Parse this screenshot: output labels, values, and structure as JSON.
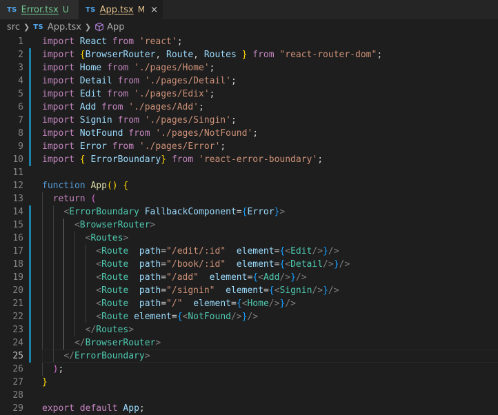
{
  "tabs": [
    {
      "name": "Error.tsx",
      "badge": "TS",
      "status": "U",
      "active": false
    },
    {
      "name": "App.tsx",
      "badge": "TS",
      "status": "M",
      "active": true,
      "close_icon": "×"
    }
  ],
  "breadcrumb": {
    "folder": "src",
    "file_badge": "TS",
    "file": "App.tsx",
    "symbol": "App"
  },
  "editor": {
    "current_line": 25,
    "lines": [
      {
        "n": "1",
        "tokens": [
          [
            "kw",
            "import"
          ],
          [
            "txt",
            " "
          ],
          [
            "var",
            "React"
          ],
          [
            "txt",
            " "
          ],
          [
            "kw",
            "from"
          ],
          [
            "txt",
            " "
          ],
          [
            "str",
            "'react'"
          ],
          [
            "txt",
            ";"
          ]
        ]
      },
      {
        "n": "2",
        "tokens": [
          [
            "kw",
            "import"
          ],
          [
            "txt",
            " "
          ],
          [
            "br1",
            "{"
          ],
          [
            "var",
            "BrowserRouter"
          ],
          [
            "txt",
            ", "
          ],
          [
            "var",
            "Route"
          ],
          [
            "txt",
            ", "
          ],
          [
            "var",
            "Routes"
          ],
          [
            "txt",
            " "
          ],
          [
            "br1",
            "}"
          ],
          [
            "txt",
            " "
          ],
          [
            "kw",
            "from"
          ],
          [
            "txt",
            " "
          ],
          [
            "str",
            "\"react-router-dom\""
          ],
          [
            "txt",
            ";"
          ]
        ]
      },
      {
        "n": "3",
        "tokens": [
          [
            "kw",
            "import"
          ],
          [
            "txt",
            " "
          ],
          [
            "var",
            "Home"
          ],
          [
            "txt",
            " "
          ],
          [
            "kw",
            "from"
          ],
          [
            "txt",
            " "
          ],
          [
            "str",
            "'./pages/Home'"
          ],
          [
            "txt",
            ";"
          ]
        ]
      },
      {
        "n": "4",
        "tokens": [
          [
            "kw",
            "import"
          ],
          [
            "txt",
            " "
          ],
          [
            "var",
            "Detail"
          ],
          [
            "txt",
            " "
          ],
          [
            "kw",
            "from"
          ],
          [
            "txt",
            " "
          ],
          [
            "str",
            "'./pages/Detail'"
          ],
          [
            "txt",
            ";"
          ]
        ]
      },
      {
        "n": "5",
        "tokens": [
          [
            "kw",
            "import"
          ],
          [
            "txt",
            " "
          ],
          [
            "var",
            "Edit"
          ],
          [
            "txt",
            " "
          ],
          [
            "kw",
            "from"
          ],
          [
            "txt",
            " "
          ],
          [
            "str",
            "'./pages/Edix'"
          ],
          [
            "txt",
            ";"
          ]
        ]
      },
      {
        "n": "6",
        "tokens": [
          [
            "kw",
            "import"
          ],
          [
            "txt",
            " "
          ],
          [
            "var",
            "Add"
          ],
          [
            "txt",
            " "
          ],
          [
            "kw",
            "from"
          ],
          [
            "txt",
            " "
          ],
          [
            "str",
            "'./pages/Add'"
          ],
          [
            "txt",
            ";"
          ]
        ]
      },
      {
        "n": "7",
        "tokens": [
          [
            "kw",
            "import"
          ],
          [
            "txt",
            " "
          ],
          [
            "var",
            "Signin"
          ],
          [
            "txt",
            " "
          ],
          [
            "kw",
            "from"
          ],
          [
            "txt",
            " "
          ],
          [
            "str",
            "'./pages/Singin'"
          ],
          [
            "txt",
            ";"
          ]
        ]
      },
      {
        "n": "8",
        "tokens": [
          [
            "kw",
            "import"
          ],
          [
            "txt",
            " "
          ],
          [
            "var",
            "NotFound"
          ],
          [
            "txt",
            " "
          ],
          [
            "kw",
            "from"
          ],
          [
            "txt",
            " "
          ],
          [
            "str",
            "'./pages/NotFound'"
          ],
          [
            "txt",
            ";"
          ]
        ]
      },
      {
        "n": "9",
        "tokens": [
          [
            "kw",
            "import"
          ],
          [
            "txt",
            " "
          ],
          [
            "var",
            "Error"
          ],
          [
            "txt",
            " "
          ],
          [
            "kw",
            "from"
          ],
          [
            "txt",
            " "
          ],
          [
            "str",
            "'./pages/Error'"
          ],
          [
            "txt",
            ";"
          ]
        ]
      },
      {
        "n": "10",
        "tokens": [
          [
            "kw",
            "import"
          ],
          [
            "txt",
            " "
          ],
          [
            "br1",
            "{"
          ],
          [
            "txt",
            " "
          ],
          [
            "var",
            "ErrorBoundary"
          ],
          [
            "br1",
            "}"
          ],
          [
            "txt",
            " "
          ],
          [
            "kw",
            "from"
          ],
          [
            "txt",
            " "
          ],
          [
            "str",
            "'react-error-boundary'"
          ],
          [
            "txt",
            ";"
          ]
        ]
      },
      {
        "n": "11",
        "tokens": []
      },
      {
        "n": "12",
        "tokens": [
          [
            "kb",
            "function"
          ],
          [
            "txt",
            " "
          ],
          [
            "fn",
            "App"
          ],
          [
            "br1",
            "()"
          ],
          [
            "txt",
            " "
          ],
          [
            "br1",
            "{"
          ]
        ]
      },
      {
        "n": "13",
        "tokens": [
          [
            "txt",
            "  "
          ],
          [
            "kw",
            "return"
          ],
          [
            "txt",
            " "
          ],
          [
            "br2",
            "("
          ]
        ]
      },
      {
        "n": "14",
        "tokens": [
          [
            "txt",
            "    "
          ],
          [
            "punct",
            "<"
          ],
          [
            "tag",
            "ErrorBoundary"
          ],
          [
            "txt",
            " "
          ],
          [
            "var",
            "FallbackComponent"
          ],
          [
            "txt",
            "="
          ],
          [
            "br3",
            "{"
          ],
          [
            "var",
            "Error"
          ],
          [
            "br3",
            "}"
          ],
          [
            "punct",
            ">"
          ]
        ]
      },
      {
        "n": "15",
        "tokens": [
          [
            "txt",
            "      "
          ],
          [
            "punct",
            "<"
          ],
          [
            "tag",
            "BrowserRouter"
          ],
          [
            "punct",
            ">"
          ]
        ]
      },
      {
        "n": "16",
        "tokens": [
          [
            "txt",
            "        "
          ],
          [
            "punct",
            "<"
          ],
          [
            "tag",
            "Routes"
          ],
          [
            "punct",
            ">"
          ]
        ]
      },
      {
        "n": "17",
        "tokens": [
          [
            "txt",
            "          "
          ],
          [
            "punct",
            "<"
          ],
          [
            "tag",
            "Route"
          ],
          [
            "txt",
            "  "
          ],
          [
            "var",
            "path"
          ],
          [
            "txt",
            "="
          ],
          [
            "str",
            "\"/edit/:id\""
          ],
          [
            "txt",
            "  "
          ],
          [
            "var",
            "element"
          ],
          [
            "txt",
            "="
          ],
          [
            "br3",
            "{"
          ],
          [
            "punct",
            "<"
          ],
          [
            "tag",
            "Edit"
          ],
          [
            "punct",
            "/>"
          ],
          [
            "br3",
            "}"
          ],
          [
            "punct",
            "/>"
          ]
        ]
      },
      {
        "n": "18",
        "tokens": [
          [
            "txt",
            "          "
          ],
          [
            "punct",
            "<"
          ],
          [
            "tag",
            "Route"
          ],
          [
            "txt",
            "  "
          ],
          [
            "var",
            "path"
          ],
          [
            "txt",
            "="
          ],
          [
            "str",
            "\"/book/:id\""
          ],
          [
            "txt",
            "  "
          ],
          [
            "var",
            "element"
          ],
          [
            "txt",
            "="
          ],
          [
            "br3",
            "{"
          ],
          [
            "punct",
            "<"
          ],
          [
            "tag",
            "Detail"
          ],
          [
            "punct",
            "/>"
          ],
          [
            "br3",
            "}"
          ],
          [
            "punct",
            "/>"
          ]
        ]
      },
      {
        "n": "19",
        "tokens": [
          [
            "txt",
            "          "
          ],
          [
            "punct",
            "<"
          ],
          [
            "tag",
            "Route"
          ],
          [
            "txt",
            "  "
          ],
          [
            "var",
            "path"
          ],
          [
            "txt",
            "="
          ],
          [
            "str",
            "\"/add\""
          ],
          [
            "txt",
            "  "
          ],
          [
            "var",
            "element"
          ],
          [
            "txt",
            "="
          ],
          [
            "br3",
            "{"
          ],
          [
            "punct",
            "<"
          ],
          [
            "tag",
            "Add"
          ],
          [
            "punct",
            "/>"
          ],
          [
            "br3",
            "}"
          ],
          [
            "punct",
            "/>"
          ]
        ]
      },
      {
        "n": "20",
        "tokens": [
          [
            "txt",
            "          "
          ],
          [
            "punct",
            "<"
          ],
          [
            "tag",
            "Route"
          ],
          [
            "txt",
            "  "
          ],
          [
            "var",
            "path"
          ],
          [
            "txt",
            "="
          ],
          [
            "str",
            "\"/signin\""
          ],
          [
            "txt",
            "  "
          ],
          [
            "var",
            "element"
          ],
          [
            "txt",
            "="
          ],
          [
            "br3",
            "{"
          ],
          [
            "punct",
            "<"
          ],
          [
            "tag",
            "Signin"
          ],
          [
            "punct",
            "/>"
          ],
          [
            "br3",
            "}"
          ],
          [
            "punct",
            "/>"
          ]
        ]
      },
      {
        "n": "21",
        "tokens": [
          [
            "txt",
            "          "
          ],
          [
            "punct",
            "<"
          ],
          [
            "tag",
            "Route"
          ],
          [
            "txt",
            "  "
          ],
          [
            "var",
            "path"
          ],
          [
            "txt",
            "="
          ],
          [
            "str",
            "\"/\""
          ],
          [
            "txt",
            "  "
          ],
          [
            "var",
            "element"
          ],
          [
            "txt",
            "="
          ],
          [
            "br3",
            "{"
          ],
          [
            "punct",
            "<"
          ],
          [
            "tag",
            "Home"
          ],
          [
            "punct",
            "/>"
          ],
          [
            "br3",
            "}"
          ],
          [
            "punct",
            "/>"
          ]
        ]
      },
      {
        "n": "22",
        "tokens": [
          [
            "txt",
            "          "
          ],
          [
            "punct",
            "<"
          ],
          [
            "tag",
            "Route"
          ],
          [
            "txt",
            " "
          ],
          [
            "var",
            "element"
          ],
          [
            "txt",
            "="
          ],
          [
            "br3",
            "{"
          ],
          [
            "punct",
            "<"
          ],
          [
            "tag",
            "NotFound"
          ],
          [
            "punct",
            "/>"
          ],
          [
            "br3",
            "}"
          ],
          [
            "punct",
            "/>"
          ]
        ]
      },
      {
        "n": "23",
        "tokens": [
          [
            "txt",
            "        "
          ],
          [
            "punct",
            "</"
          ],
          [
            "tag",
            "Routes"
          ],
          [
            "punct",
            ">"
          ]
        ]
      },
      {
        "n": "24",
        "tokens": [
          [
            "txt",
            "      "
          ],
          [
            "punct",
            "</"
          ],
          [
            "tag",
            "BrowserRouter"
          ],
          [
            "punct",
            ">"
          ]
        ]
      },
      {
        "n": "25",
        "tokens": [
          [
            "txt",
            "    "
          ],
          [
            "punct",
            "</"
          ],
          [
            "tag",
            "ErrorBoundary"
          ],
          [
            "punct",
            ">"
          ]
        ]
      },
      {
        "n": "26",
        "tokens": [
          [
            "txt",
            "  "
          ],
          [
            "br2",
            ")"
          ],
          [
            "txt",
            ";"
          ]
        ]
      },
      {
        "n": "27",
        "tokens": [
          [
            "br1",
            "}"
          ]
        ]
      },
      {
        "n": "28",
        "tokens": []
      },
      {
        "n": "29",
        "tokens": [
          [
            "kw",
            "export"
          ],
          [
            "txt",
            " "
          ],
          [
            "kw",
            "default"
          ],
          [
            "txt",
            " "
          ],
          [
            "var",
            "App"
          ],
          [
            "txt",
            ";"
          ]
        ]
      }
    ]
  },
  "icons": {
    "chevron": "chevron-right-icon",
    "symbol": "cube-icon"
  },
  "colors": {
    "background": "#1e1e1e",
    "keyword": "#c586c0",
    "string": "#ce9178",
    "variable": "#9cdcfe",
    "component": "#4ec9b0",
    "modified_gutter": "#1b81a8"
  }
}
